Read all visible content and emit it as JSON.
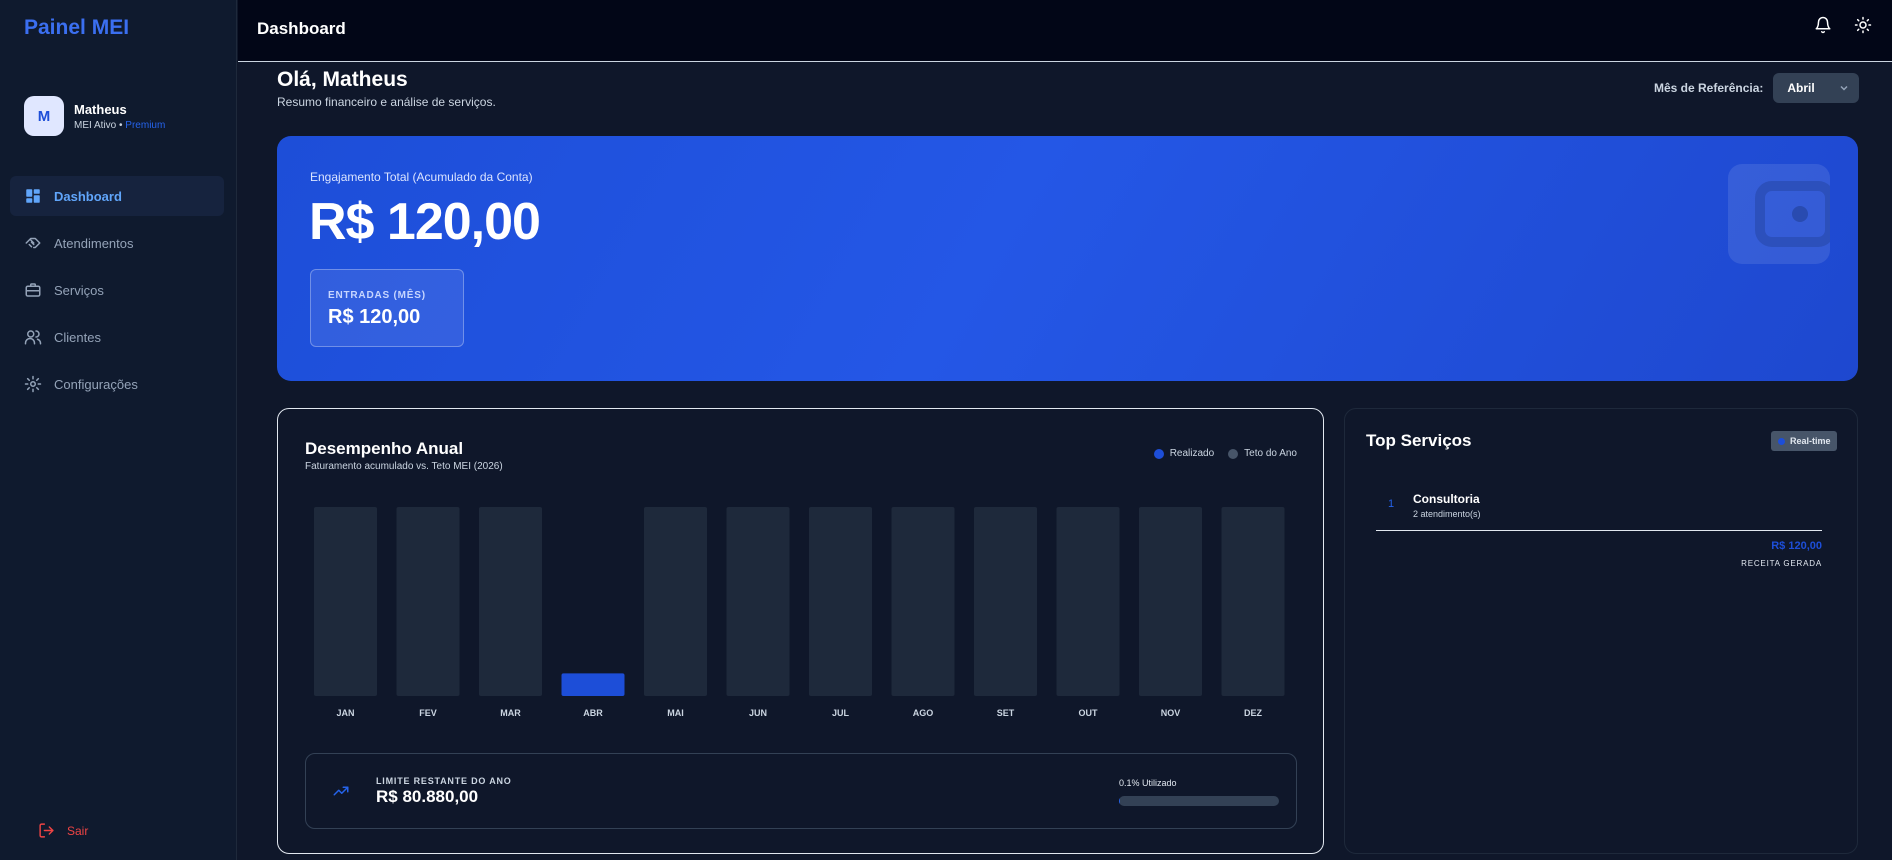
{
  "app": {
    "brand": "Painel MEI"
  },
  "user": {
    "initial": "M",
    "name": "Matheus",
    "status": "MEI Ativo •",
    "plan": "Premium"
  },
  "sidebar": {
    "items": [
      {
        "label": "Dashboard",
        "icon": "dashboard-icon",
        "active": true
      },
      {
        "label": "Atendimentos",
        "icon": "handshake-icon"
      },
      {
        "label": "Serviços",
        "icon": "briefcase-icon"
      },
      {
        "label": "Clientes",
        "icon": "users-icon"
      },
      {
        "label": "Configurações",
        "icon": "gear-icon"
      }
    ],
    "logout_label": "Sair"
  },
  "header": {
    "title": "Dashboard"
  },
  "main": {
    "greeting": "Olá, Matheus",
    "subtitle": "Resumo financeiro e análise de serviços.",
    "month_label": "Mês de Referência:",
    "month_value": "Abril"
  },
  "hero": {
    "label": "Engajamento Total (Acumulado da Conta)",
    "value": "R$ 120,00",
    "card_label": "ENTRADAS (MÊS)",
    "card_value": "R$ 120,00"
  },
  "annual": {
    "title": "Desempenho Anual",
    "subtitle": "Faturamento acumulado vs. Teto MEI (2026)",
    "legend_realizado": "Realizado",
    "legend_teto": "Teto do Ano",
    "limit_label": "LIMITE RESTANTE DO ANO",
    "limit_value": "R$ 80.880,00",
    "usage_label": "0.1% Utilizado",
    "usage_fraction": 0.001
  },
  "colors": {
    "realizado": "#1d4ed8",
    "teto": "#475569",
    "accent": "#2563eb"
  },
  "chart_data": {
    "type": "bar",
    "categories": [
      "JAN",
      "FEV",
      "MAR",
      "ABR",
      "MAI",
      "JUN",
      "JUL",
      "AGO",
      "SET",
      "OUT",
      "NOV",
      "DEZ"
    ],
    "series": [
      {
        "name": "Realizado",
        "values": [
          0,
          0,
          0,
          120,
          0,
          0,
          0,
          0,
          0,
          0,
          0,
          0
        ]
      },
      {
        "name": "Teto do Ano",
        "values": [
          1000,
          1000,
          1000,
          0,
          1000,
          1000,
          1000,
          1000,
          1000,
          1000,
          1000,
          1000
        ]
      }
    ],
    "ylim": [
      0,
      1000
    ],
    "grid": false,
    "legend": "top-right"
  },
  "top_services": {
    "title": "Top Serviços",
    "badge": "Real-time",
    "items": [
      {
        "rank": "1",
        "name": "Consultoria",
        "count": "2 atendimento(s)",
        "revenue": "R$ 120,00",
        "revenue_label": "RECEITA GERADA"
      }
    ]
  }
}
